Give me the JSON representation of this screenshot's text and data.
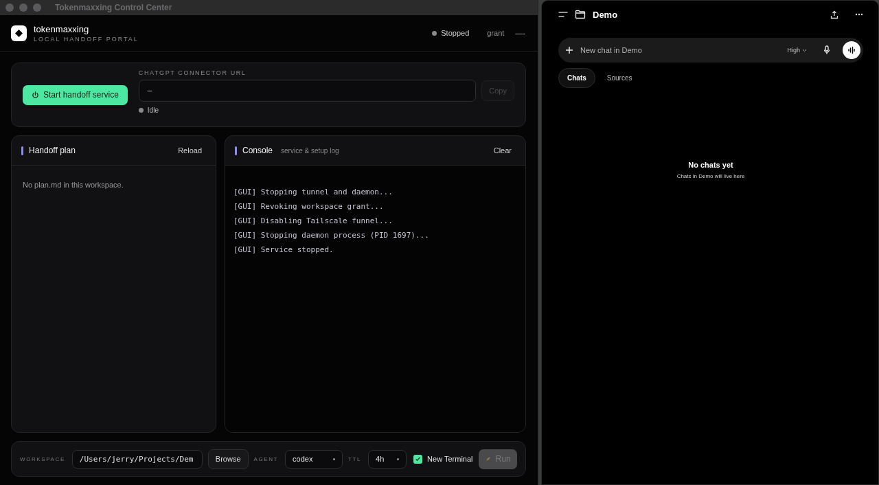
{
  "window": {
    "title": "Tokenmaxxing Control Center"
  },
  "header": {
    "brand": "tokenmaxxing",
    "tagline": "LOCAL HANDOFF PORTAL",
    "status": {
      "label": "Stopped",
      "running": false
    },
    "grant": {
      "label": "grant",
      "value": "—-"
    }
  },
  "service": {
    "start_button": "Start handoff service",
    "url_label": "CHATGPT CONNECTOR URL",
    "url_value": "–",
    "copy_button": "Copy",
    "copy_disabled": true,
    "state": {
      "label": "Idle",
      "running": false
    }
  },
  "plan": {
    "title": "Handoff plan",
    "action": "Reload",
    "empty": "No plan.md in this workspace."
  },
  "console": {
    "title": "Console",
    "subtitle": "service & setup log",
    "action": "Clear",
    "lines": [
      "[GUI] Stopping tunnel and daemon...",
      "[GUI] Revoking workspace grant...",
      "[GUI] Disabling Tailscale funnel...",
      "[GUI] Stopping daemon process (PID 1697)...",
      "[GUI] Service stopped."
    ]
  },
  "run_bar": {
    "workspace_label": "WORKSPACE",
    "workspace_value": "/Users/jerry/Projects/Dem",
    "browse_button": "Browse",
    "agent_label": "AGENT",
    "agent_value": "codex",
    "ttl_label": "TTL",
    "ttl_value": "4h",
    "new_terminal": {
      "label": "New Terminal",
      "checked": true
    },
    "run_button": "Run",
    "run_disabled": true
  },
  "chat_panel": {
    "title": "Demo",
    "composer": {
      "placeholder": "New chat in Demo",
      "effort": "High"
    },
    "tabs": [
      {
        "label": "Chats",
        "selected": true
      },
      {
        "label": "Sources",
        "selected": false
      }
    ],
    "empty": {
      "title": "No chats yet",
      "subtitle": "Chats in Demo will live here"
    }
  }
}
